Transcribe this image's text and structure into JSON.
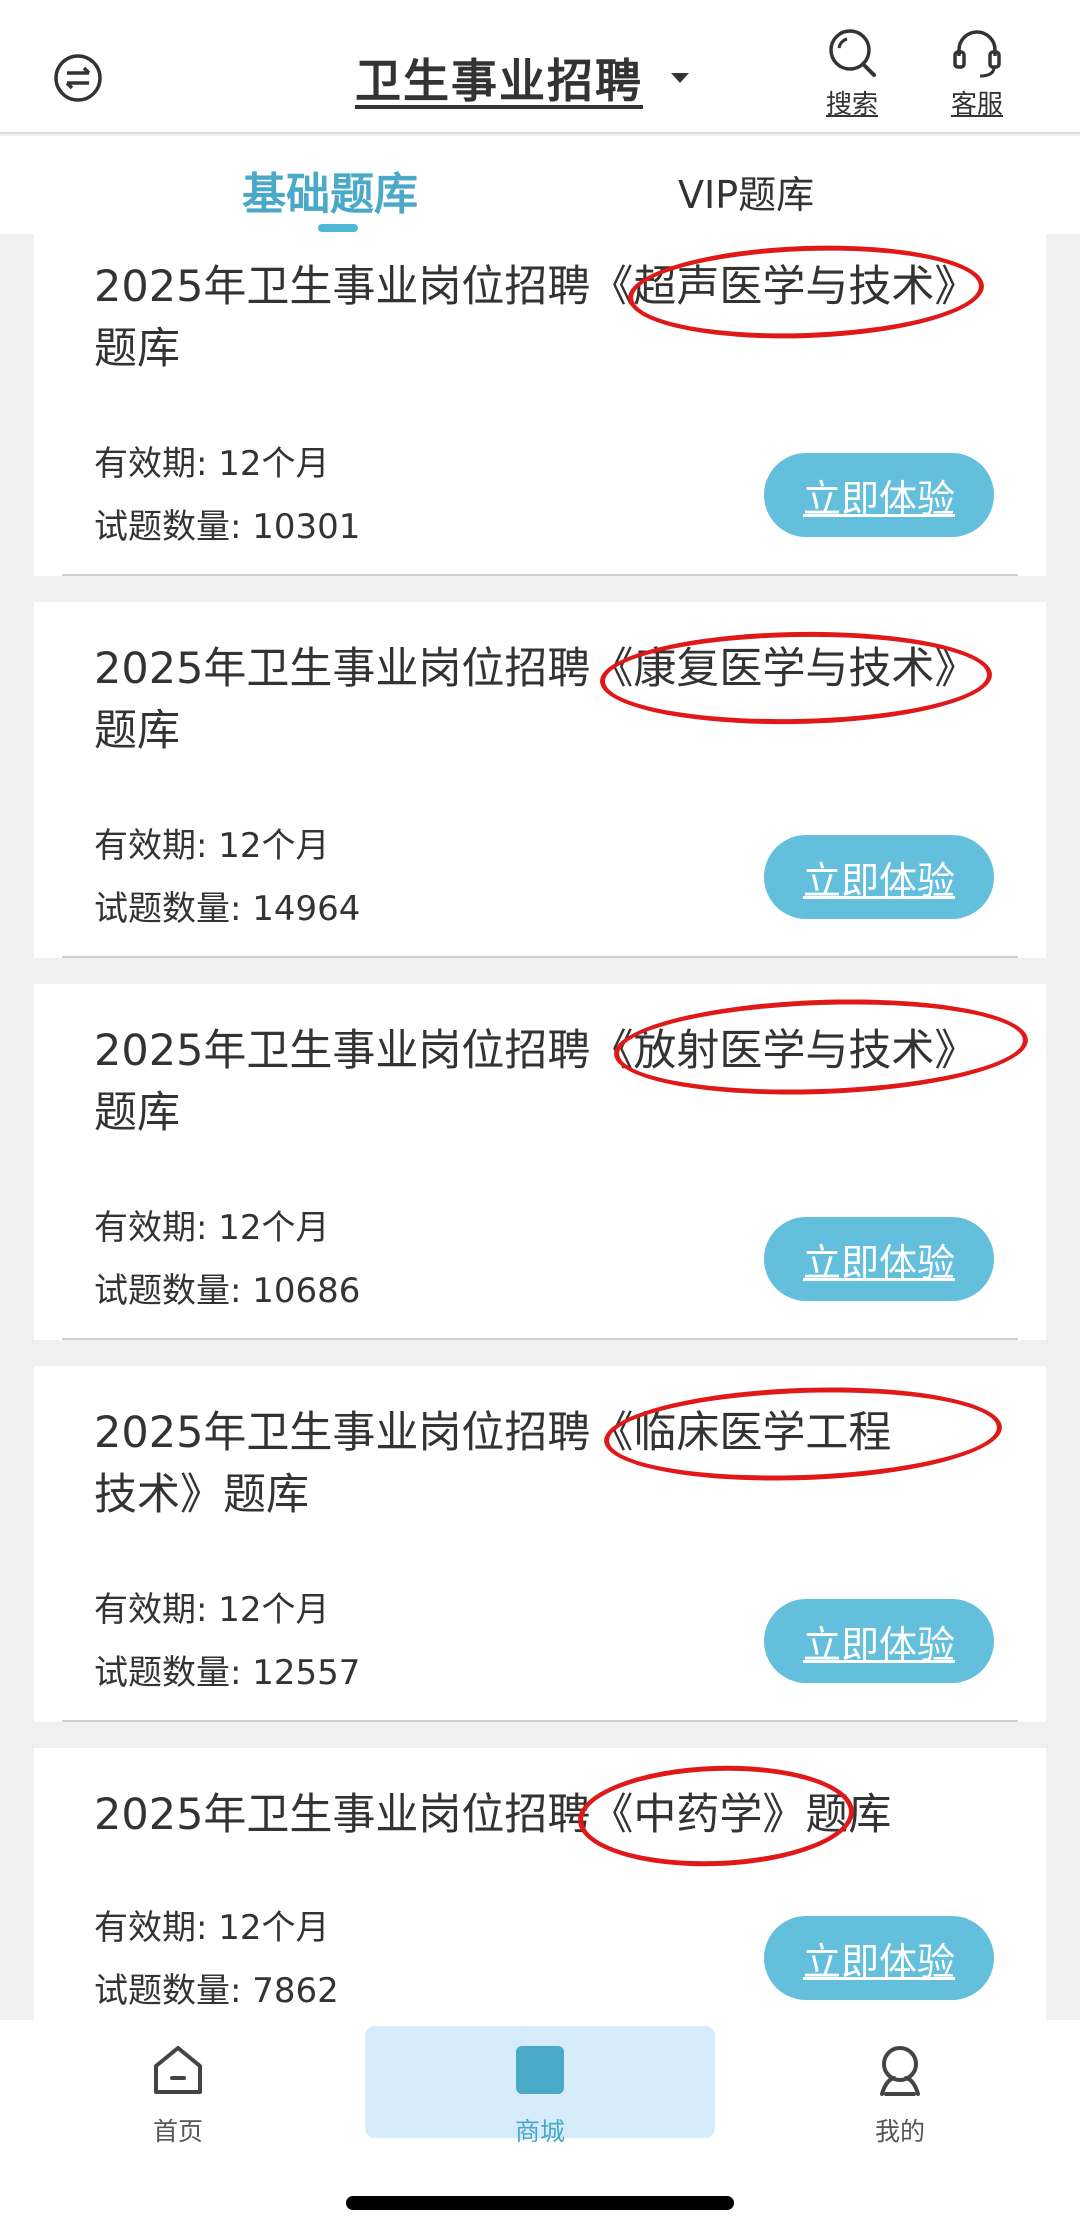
{
  "header": {
    "title": "卫生事业招聘",
    "search_label": "搜索",
    "service_label": "客服"
  },
  "tabs": [
    {
      "label": "基础题库",
      "active": true
    },
    {
      "label": "VIP题库",
      "active": false
    }
  ],
  "cards": [
    {
      "name": "2025年卫生事业岗位招聘《超声医学与技术》题库",
      "validity": "有效期: 12个月",
      "count": "试题数量: 10301",
      "button": "立即体验"
    },
    {
      "name": "2025年卫生事业岗位招聘《康复医学与技术》题库",
      "validity": "有效期: 12个月",
      "count": "试题数量: 14964",
      "button": "立即体验"
    },
    {
      "name": "2025年卫生事业岗位招聘《放射医学与技术》题库",
      "validity": "有效期: 12个月",
      "count": "试题数量: 10686",
      "button": "立即体验"
    },
    {
      "name": "2025年卫生事业岗位招聘《临床医学工程技术》题库",
      "validity": "有效期: 12个月",
      "count": "试题数量: 12557",
      "button": "立即体验"
    },
    {
      "name": "2025年卫生事业岗位招聘《中药学》题库",
      "validity": "有效期: 12个月",
      "count": "试题数量: 7862",
      "button": "立即体验"
    }
  ],
  "bottom_nav": [
    {
      "label": "首页",
      "icon": "home-icon",
      "active": false
    },
    {
      "label": "商城",
      "icon": "mall-icon",
      "active": true
    },
    {
      "label": "我的",
      "icon": "user-icon",
      "active": false
    }
  ],
  "colors": {
    "accent": "#4aa9c7",
    "button": "#63bfdc",
    "annotation": "#e01818",
    "active_nav_bg": "#d6ecfb"
  }
}
